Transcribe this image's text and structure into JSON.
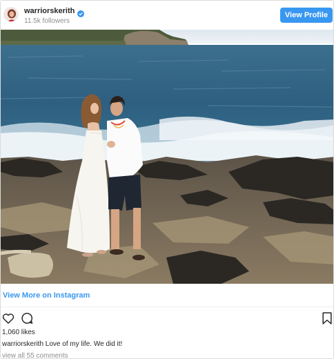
{
  "header": {
    "username": "warriorskerith",
    "followers": "11.5k followers",
    "view_profile_label": "View Profile",
    "verified_icon": "verified-badge-icon"
  },
  "colors": {
    "accent": "#3897f0",
    "text": "#262626",
    "muted": "#8e8e8e"
  },
  "view_more_label": "View More on Instagram",
  "actions": {
    "icons": [
      "heart-icon",
      "comment-icon",
      "bookmark-icon"
    ]
  },
  "likes": "1,060 likes",
  "caption": {
    "username": "warriorskerith",
    "text": "Love of my life. We did it!"
  },
  "view_comments": "view all 55 comments"
}
